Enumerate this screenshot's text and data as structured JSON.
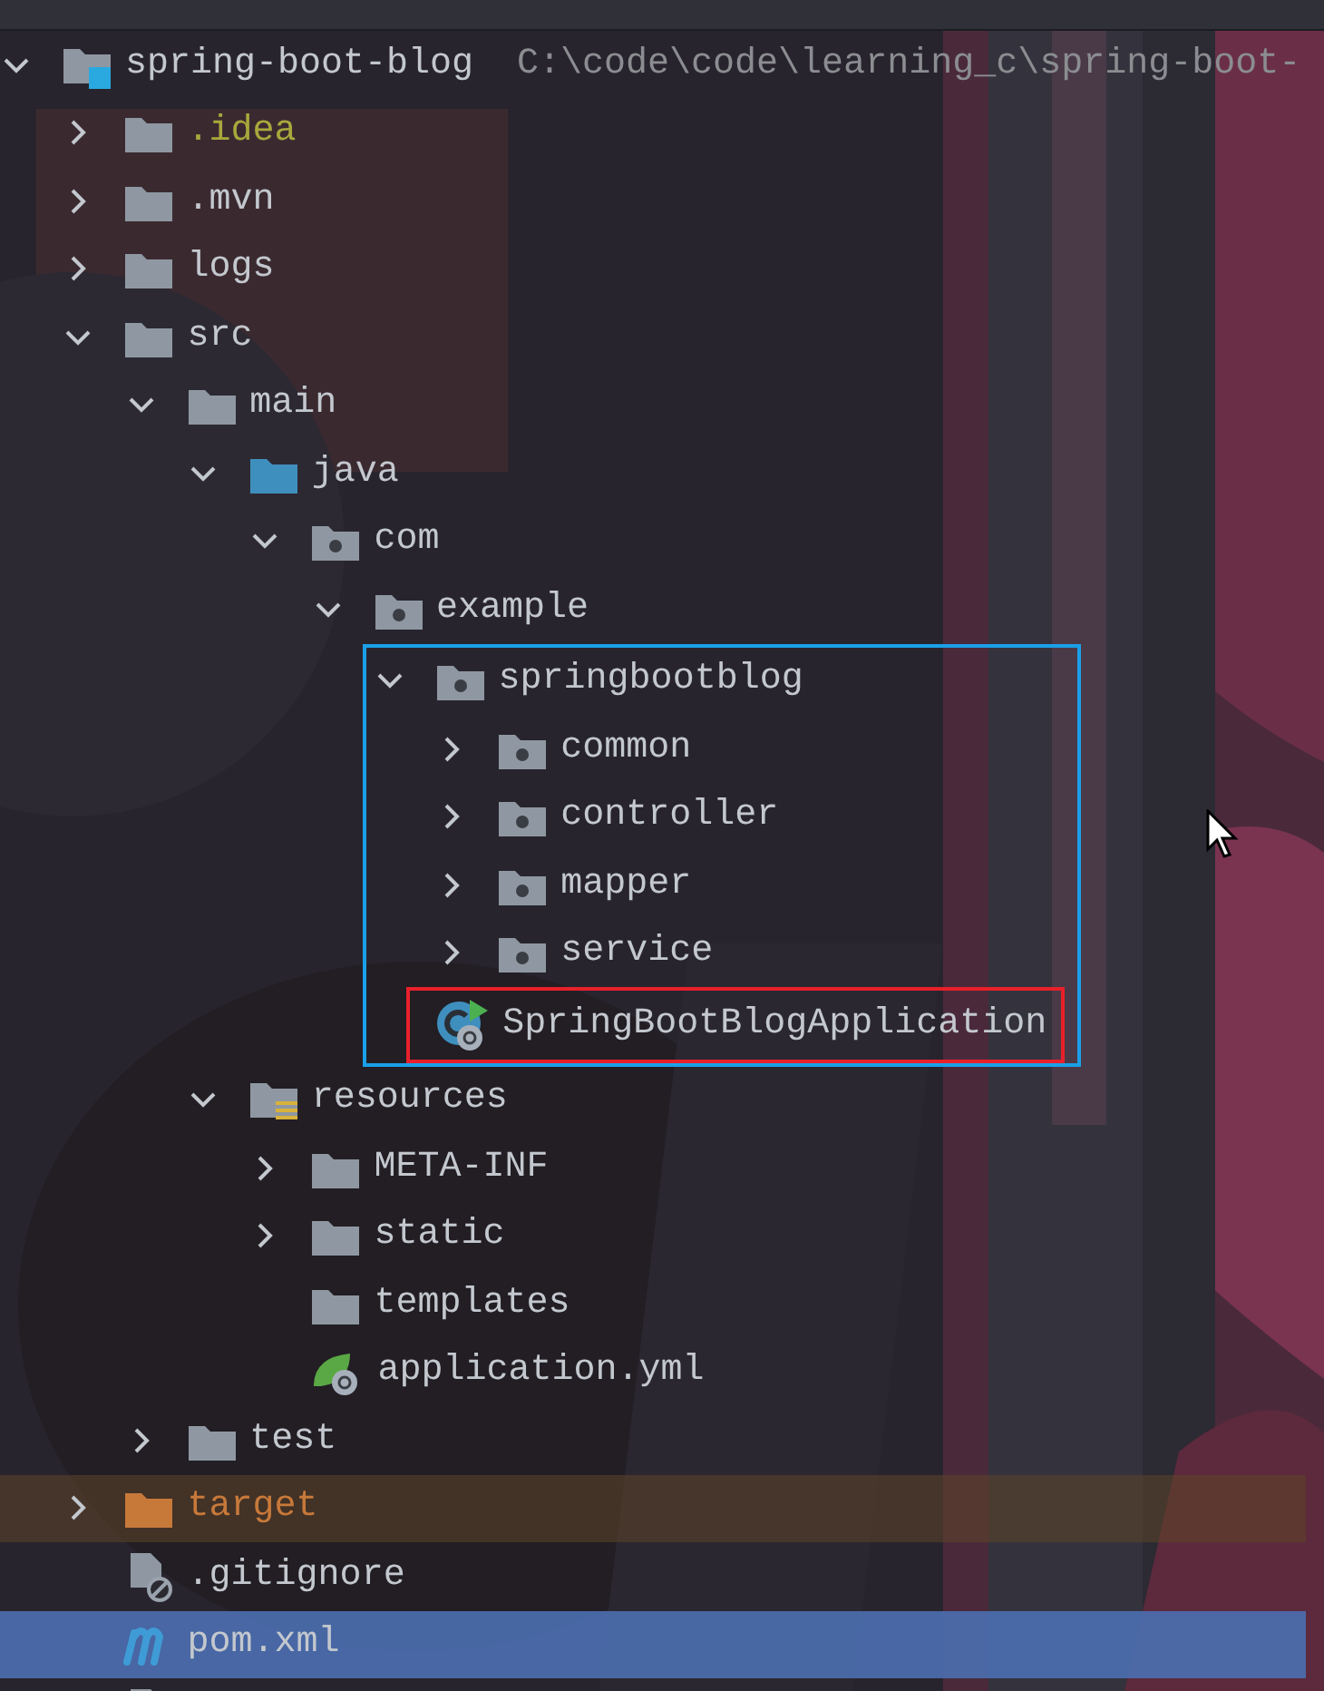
{
  "project_tree": {
    "root": {
      "label": "spring-boot-blog",
      "kind": "module",
      "path": "C:\\code\\code\\learning_c\\spring-boot-",
      "expanded": true,
      "selected": false,
      "children": [
        {
          "label": ".idea",
          "kind": "folder",
          "expanded": false,
          "selected": false,
          "color": "#a9a83c"
        },
        {
          "label": ".mvn",
          "kind": "folder",
          "expanded": false,
          "selected": false
        },
        {
          "label": "logs",
          "kind": "folder",
          "expanded": false,
          "selected": false
        },
        {
          "label": "src",
          "kind": "folder",
          "expanded": true,
          "selected": false,
          "children": [
            {
              "label": "main",
              "kind": "folder",
              "expanded": true,
              "selected": false,
              "children": [
                {
                  "label": "java",
                  "kind": "source_root",
                  "expanded": true,
                  "selected": false,
                  "children": [
                    {
                      "label": "com",
                      "kind": "package",
                      "expanded": true,
                      "selected": false,
                      "children": [
                        {
                          "label": "example",
                          "kind": "package",
                          "expanded": true,
                          "selected": false,
                          "children": [
                            {
                              "label": "springbootblog",
                              "kind": "package",
                              "expanded": true,
                              "selected": false,
                              "frame": {
                                "color": "#1aa0e8"
                              },
                              "children": [
                                {
                                  "label": "common",
                                  "kind": "package",
                                  "expanded": false,
                                  "selected": false
                                },
                                {
                                  "label": "controller",
                                  "kind": "package",
                                  "expanded": false,
                                  "selected": false
                                },
                                {
                                  "label": "mapper",
                                  "kind": "package",
                                  "expanded": false,
                                  "selected": false
                                },
                                {
                                  "label": "service",
                                  "kind": "package",
                                  "expanded": false,
                                  "selected": false
                                },
                                {
                                  "label": "SpringBootBlogApplication",
                                  "kind": "spring_app",
                                  "selected": false,
                                  "frame": {
                                    "color": "#e8202a"
                                  }
                                }
                              ]
                            }
                          ]
                        }
                      ]
                    }
                  ]
                },
                {
                  "label": "resources",
                  "kind": "resource_root",
                  "expanded": true,
                  "selected": false,
                  "children": [
                    {
                      "label": "META-INF",
                      "kind": "folder",
                      "expanded": false,
                      "selected": false
                    },
                    {
                      "label": "static",
                      "kind": "folder",
                      "expanded": false,
                      "selected": false
                    },
                    {
                      "label": "templates",
                      "kind": "folder",
                      "selected": false
                    },
                    {
                      "label": "application.yml",
                      "kind": "yaml",
                      "selected": false
                    }
                  ]
                }
              ]
            },
            {
              "label": "test",
              "kind": "folder",
              "expanded": false,
              "selected": false
            }
          ]
        },
        {
          "label": "target",
          "kind": "excluded",
          "expanded": false,
          "selected": false,
          "color": "#c7793a"
        },
        {
          "label": ".gitignore",
          "kind": "ignore_file",
          "selected": false
        },
        {
          "label": "pom.xml",
          "kind": "maven",
          "selected": true
        },
        {
          "kind": "file",
          "selected": false
        }
      ]
    }
  }
}
